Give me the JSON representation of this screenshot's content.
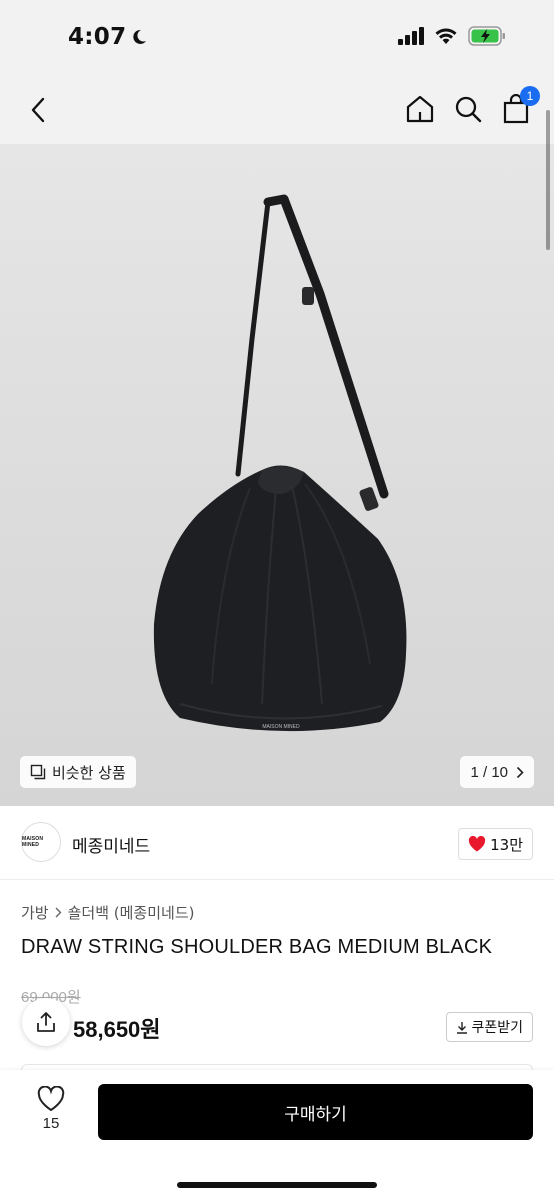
{
  "status_bar": {
    "time": "4:07"
  },
  "nav": {
    "cart_count": "1"
  },
  "hero": {
    "similar_label": "비슷한 상품",
    "page_indicator": "1 / 10",
    "bag_print": "MAISON MINED"
  },
  "brand": {
    "logo_text": "MAISON MINED",
    "name": "메종미네드",
    "like_count": "13만"
  },
  "product": {
    "breadcrumb": [
      "가방",
      "숄더백 (메종미네드)"
    ],
    "title": "DRAW STRING SHOULDER BAG MEDIUM BLACK",
    "original_price": "69,000원",
    "sale_price": "58,650원",
    "coupon_label": "쿠폰받기"
  },
  "bottom_bar": {
    "wish_count": "15",
    "buy_label": "구매하기"
  },
  "colors": {
    "badge": "#1a6cf0",
    "heart": "#e8192c",
    "buy_bg": "#000000"
  }
}
